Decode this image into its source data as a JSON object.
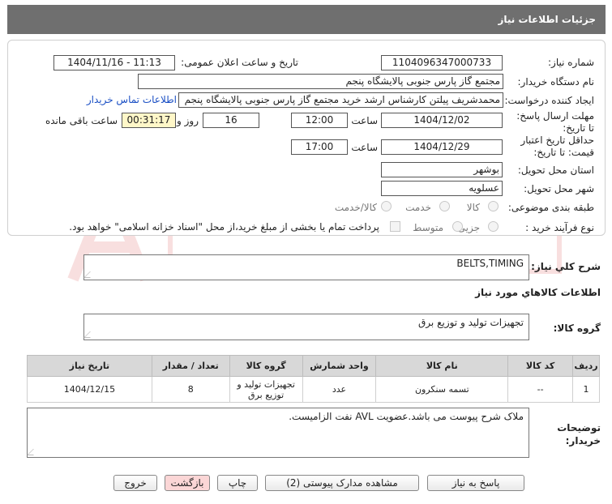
{
  "header": {
    "title": "جزئیات اطلاعات نیاز"
  },
  "form": {
    "need_number_label": "شماره نیاز:",
    "need_number": "1104096347000733",
    "announce_label": "تاریخ و ساعت اعلان عمومی:",
    "announce_value": "1404/11/16 - 11:13",
    "buyer_org_label": "نام دستگاه خریدار:",
    "buyer_org": "مجتمع گاز پارس جنوبی  پالایشگاه پنجم",
    "creator_label": "ایجاد کننده درخواست:",
    "creator": "محمدشریف پیلتن کارشناس ارشد خرید مجتمع گاز پارس جنوبی  پالایشگاه پنجم",
    "contact_link": "اطلاعات تماس خریدار",
    "reply_deadline_label": "مهلت ارسال پاسخ: تا تاریخ:",
    "reply_date": "1404/12/02",
    "time_label": "ساعت",
    "reply_time": "12:00",
    "days_value": "16",
    "days_label": "روز و",
    "remaining_value": "00:31:17",
    "remaining_label": "ساعت باقی مانده",
    "validity_label": "حداقل تاریخ اعتبار قیمت: تا تاریخ:",
    "validity_date": "1404/12/29",
    "validity_time": "17:00",
    "province_label": "استان محل تحویل:",
    "province": "بوشهر",
    "city_label": "شهر محل تحویل:",
    "city": "عسلویه",
    "category_label": "طبقه بندی موضوعی:",
    "category_options": [
      "کالا",
      "خدمت",
      "کالا/خدمت"
    ],
    "process_label": "نوع فرآیند خرید :",
    "process_options": [
      "جزیی",
      "متوسط"
    ],
    "payment_note": "پرداخت تمام یا بخشی از مبلغ خرید،از محل \"اسناد خزانه اسلامی\" خواهد بود."
  },
  "summary": {
    "label": "شرح کلي نياز:",
    "value": "BELTS,TIMING",
    "goods_info_label": "اطلاعات کالاهاي مورد نياز",
    "group_label": "گروه کالا:",
    "group_value": "تجهیزات تولید و توزیع برق"
  },
  "table": {
    "headers": [
      "ردیف",
      "کد کالا",
      "نام کالا",
      "واحد شمارش",
      "گروه کالا",
      "تعداد / مقدار",
      "تاریخ نیاز"
    ],
    "rows": [
      [
        "1",
        "--",
        "تسمه سنکرون",
        "عدد",
        "تجهیزات تولید و توزیع برق",
        "8",
        "1404/12/15"
      ]
    ]
  },
  "buyer_notes": {
    "label": "توضیحات خریدار:",
    "value": "ملاک شرح پیوست می باشد.عضویت AVL نفت الزامیست."
  },
  "buttons": {
    "reply": "پاسخ به نیاز",
    "docs": "مشاهده مدارک پیوستی (2)",
    "print": "چاپ",
    "back": "بازگشت",
    "exit": "خروج"
  },
  "colors": {
    "titlebar": "#6f6f6f",
    "link": "#1a4fc4",
    "remaining_bg": "#fff7c8"
  }
}
